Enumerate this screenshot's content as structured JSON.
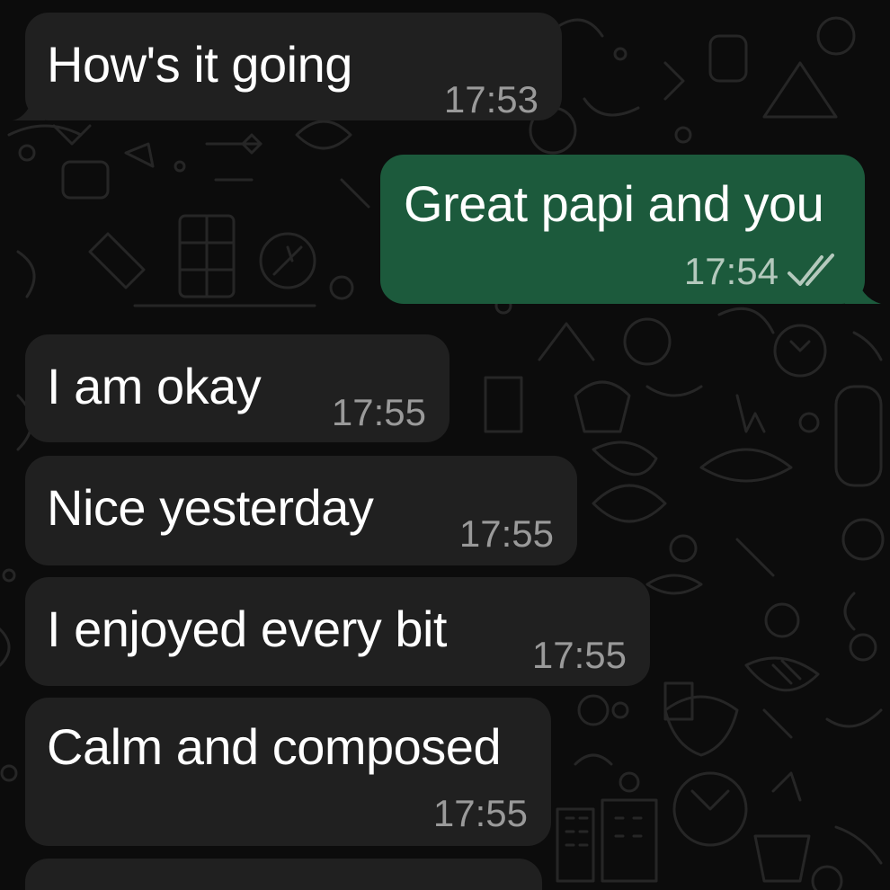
{
  "messages": [
    {
      "direction": "incoming",
      "text": "How's it going",
      "time": "17:53"
    },
    {
      "direction": "outgoing",
      "text": "Great papi and you",
      "time": "17:54",
      "status_icon": "double-check-icon",
      "status": "read"
    },
    {
      "direction": "incoming",
      "text": "I am okay",
      "time": "17:55"
    },
    {
      "direction": "incoming",
      "text": "Nice yesterday",
      "time": "17:55"
    },
    {
      "direction": "incoming",
      "text": "I enjoyed every bit",
      "time": "17:55"
    },
    {
      "direction": "incoming",
      "text": "Calm and composed",
      "time": "17:55"
    }
  ],
  "colors": {
    "incoming_bubble": "#202020",
    "outgoing_bubble": "#1c5a3c",
    "wallpaper": "#0c0c0c",
    "timestamp": "#9a9a9a",
    "read_ticks": "#b4c9bd"
  }
}
